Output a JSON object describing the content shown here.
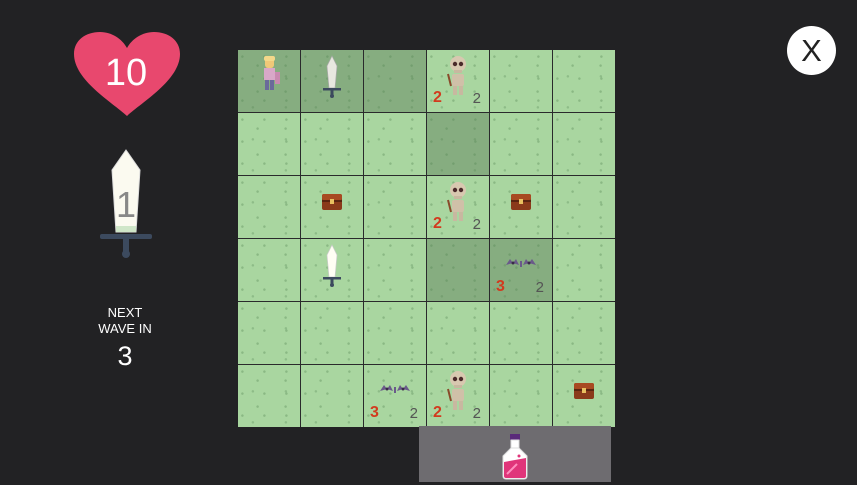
{
  "hud": {
    "health": "10",
    "attack": "1",
    "wave_label": "NEXT\nWAVE IN",
    "wave_count": "3",
    "close_label": "X"
  },
  "colors": {
    "heart": "#e8486e",
    "grass": "#a9d6a0",
    "visited": "#86ad80",
    "enemy_attack": "#d23a1e",
    "potion": "#e0357a"
  },
  "board": {
    "rows": 6,
    "cols": 6,
    "cells": [
      [
        {
          "type": "player",
          "visited": true
        },
        {
          "type": "sword",
          "visited": true
        },
        {
          "type": "empty",
          "visited": true
        },
        {
          "type": "skeleton",
          "atk": "2",
          "hp": "2"
        },
        {
          "type": "empty"
        },
        {
          "type": "empty"
        }
      ],
      [
        {
          "type": "empty"
        },
        {
          "type": "empty"
        },
        {
          "type": "empty"
        },
        {
          "type": "empty",
          "visited": true
        },
        {
          "type": "empty"
        },
        {
          "type": "empty"
        }
      ],
      [
        {
          "type": "empty"
        },
        {
          "type": "chest"
        },
        {
          "type": "empty"
        },
        {
          "type": "skeleton",
          "atk": "2",
          "hp": "2"
        },
        {
          "type": "chest"
        },
        {
          "type": "empty"
        }
      ],
      [
        {
          "type": "empty"
        },
        {
          "type": "sword-white"
        },
        {
          "type": "empty"
        },
        {
          "type": "empty",
          "visited": true
        },
        {
          "type": "bats",
          "atk": "3",
          "hp": "2",
          "visited": true
        },
        {
          "type": "empty"
        }
      ],
      [
        {
          "type": "empty"
        },
        {
          "type": "empty"
        },
        {
          "type": "empty"
        },
        {
          "type": "empty"
        },
        {
          "type": "empty"
        },
        {
          "type": "empty"
        }
      ],
      [
        {
          "type": "empty"
        },
        {
          "type": "empty"
        },
        {
          "type": "bats",
          "atk": "3",
          "hp": "2"
        },
        {
          "type": "skeleton",
          "atk": "2",
          "hp": "2"
        },
        {
          "type": "empty"
        },
        {
          "type": "chest"
        }
      ]
    ]
  },
  "inventory": {
    "items": [
      {
        "icon": "potion-icon"
      }
    ]
  }
}
